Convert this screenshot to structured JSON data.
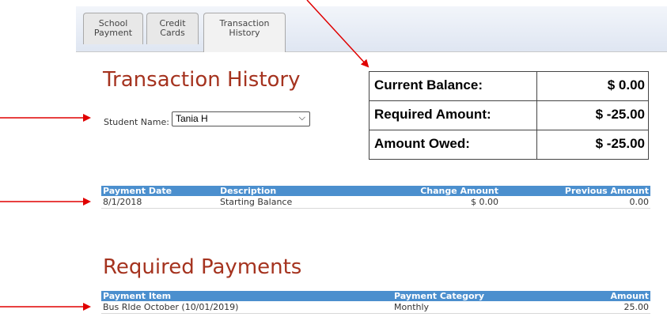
{
  "tabs": [
    {
      "label_line1": "School",
      "label_line2": "Payment"
    },
    {
      "label_line1": "Credit",
      "label_line2": "Cards"
    },
    {
      "label_line1": "Transaction",
      "label_line2": "History"
    }
  ],
  "page_title": "Transaction History",
  "student": {
    "label": "Student Name:",
    "selected": "Tania H"
  },
  "balance_box": {
    "rows": [
      {
        "label": "Current Balance:",
        "value": "$ 0.00"
      },
      {
        "label": "Required Amount:",
        "value": "$ -25.00"
      },
      {
        "label": "Amount Owed:",
        "value": "$ -25.00"
      }
    ]
  },
  "transactions": {
    "headers": [
      "Payment Date",
      "Description",
      "Change Amount",
      "Previous Amount"
    ],
    "rows": [
      [
        "8/1/2018",
        "Starting Balance",
        "$ 0.00",
        "0.00"
      ]
    ]
  },
  "required_payments": {
    "title": "Required Payments",
    "headers": [
      "Payment Item",
      "Payment Category",
      "Amount"
    ],
    "rows": [
      [
        "Bus RIde October (10/01/2019)",
        "Monthly",
        "25.00"
      ]
    ]
  },
  "colors": {
    "heading": "#a5331f",
    "table_header": "#4b8fce",
    "annotation_arrow": "#e00000"
  }
}
